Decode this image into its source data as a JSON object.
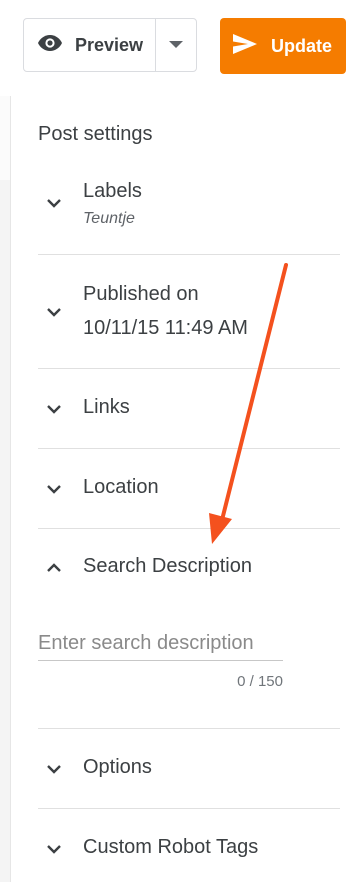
{
  "toolbar": {
    "preview_label": "Preview",
    "update_label": "Update",
    "update_color": "#f57c00"
  },
  "panel": {
    "title": "Post settings",
    "labels": {
      "title": "Labels",
      "value": "Teuntje"
    },
    "published": {
      "title": "Published on",
      "value": "10/11/15 11:49 AM"
    },
    "links": {
      "title": "Links"
    },
    "location": {
      "title": "Location"
    },
    "search_description": {
      "title": "Search Description",
      "placeholder": "Enter search description",
      "value": "",
      "counter": "0 / 150",
      "expanded": true
    },
    "options": {
      "title": "Options"
    },
    "robot_tags": {
      "title": "Custom Robot Tags"
    }
  },
  "annotation": {
    "arrow_color": "#f4511e"
  }
}
